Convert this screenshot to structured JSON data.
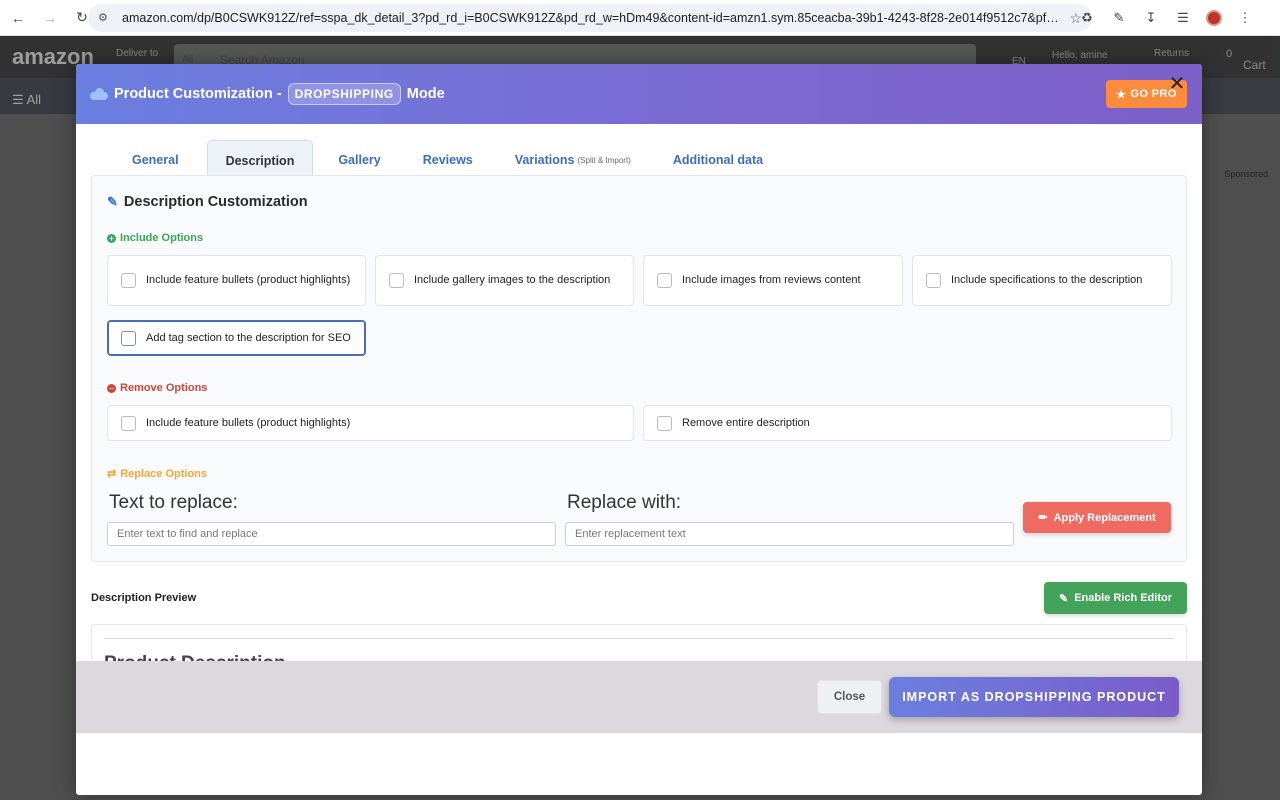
{
  "browser": {
    "url": "amazon.com/dp/B0CSWK912Z/ref=sspa_dk_detail_3?pd_rd_i=B0CSWK912Z&pd_rd_w=hDm49&content-id=amzn1.sym.85ceacba-39b1-4243-8f28-2e014f9512c7&pf_rd_p=85ceacba..."
  },
  "amazon": {
    "logo": "amazon",
    "deliver": "Deliver to",
    "search_placeholder": "Search Amazon",
    "search_cat": "All",
    "lang": "EN",
    "hello": "Hello, amine",
    "returns": "Returns",
    "cart": "Cart",
    "cart_count": "0",
    "all_menu": "All",
    "sponsored": "Sponsored"
  },
  "modal": {
    "title_prefix": "Product Customization -",
    "title_pill": "DROPSHIPPING",
    "title_suffix": "Mode",
    "go_pro": "GO PRO",
    "tabs": [
      {
        "label": "General",
        "note": ""
      },
      {
        "label": "Description",
        "note": ""
      },
      {
        "label": "Gallery",
        "note": ""
      },
      {
        "label": "Reviews",
        "note": ""
      },
      {
        "label": "Variations",
        "note": "(Split & Import)"
      },
      {
        "label": "Additional data",
        "note": ""
      }
    ],
    "section_title": "Description Customization",
    "include_title": "Include Options",
    "include_options": [
      "Include feature bullets (product highlights)",
      "Include gallery images to the description",
      "Include images from reviews content",
      "Include specifications to the description",
      "Add tag section to the description for SEO"
    ],
    "remove_title": "Remove Options",
    "remove_options": [
      "Include feature bullets (product highlights)",
      "Remove entire description"
    ],
    "replace_title": "Replace Options",
    "text_to_replace_label": "Text to replace:",
    "replace_with_label": "Replace with:",
    "text_to_replace_placeholder": "Enter text to find and replace",
    "replace_with_placeholder": "Enter replacement text",
    "apply_button": "Apply Replacement",
    "preview_label": "Description Preview",
    "rich_editor_button": "Enable Rich Editor",
    "preview_heading": "Product Description",
    "close_button": "Close",
    "import_button": "IMPORT AS DROPSHIPPING PRODUCT"
  },
  "colors": {
    "header_start": "#6a7fe0",
    "header_end": "#7c5fc8",
    "go_pro": "#ff8b3d",
    "apply": "#ef6a61",
    "rich": "#44a35a",
    "include": "#3aa657",
    "remove": "#d0463b",
    "replace": "#f0a735"
  }
}
